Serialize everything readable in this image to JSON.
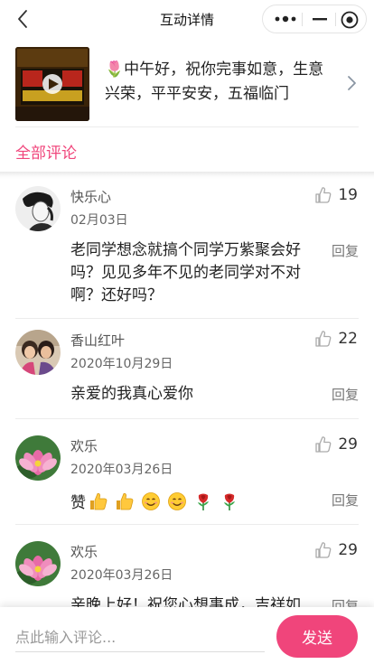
{
  "nav": {
    "title": "互动详情",
    "back_icon": "chevron-left-icon",
    "more_icon": "more-dots-icon",
    "minimize_icon": "minimize-icon",
    "close_icon": "target-circle-icon"
  },
  "post": {
    "text": "🌷中午好，祝你完事如意，生意兴荣，平平安安，五福临门",
    "thumbnail_icon": "video-thumbnail-icon",
    "arrow_icon": "chevron-right-icon"
  },
  "comments_header": "全部评论",
  "comments": [
    {
      "name": "快乐心",
      "date": "02月03日",
      "likes": "19",
      "text": "老同学想念就搞个同学万紫聚会好吗？见见多年不见的老同学对不对啊？还好吗？",
      "reply": "回复",
      "avatar": "sketch-avatar"
    },
    {
      "name": "香山红叶",
      "date": "2020年10月29日",
      "likes": "22",
      "text": "亲爱的我真心爱你",
      "reply": "回复",
      "avatar": "photo-avatar"
    },
    {
      "name": "欢乐",
      "date": "2020年03月26日",
      "likes": "29",
      "text": "赞",
      "reply": "回复",
      "avatar": "lotus-avatar",
      "emojis": [
        "thumbs-up-icon",
        "thumbs-up-icon",
        "smile-icon",
        "smile-icon",
        "rose-icon",
        "rose-icon"
      ]
    },
    {
      "name": "欢乐",
      "date": "2020年03月26日",
      "likes": "29",
      "text": "亲晚上好！祝您心想事成，吉祥如",
      "reply": "回复",
      "avatar": "lotus-avatar"
    }
  ],
  "input": {
    "placeholder": "点此输入评论..."
  },
  "send_label": "发送",
  "colors": {
    "accent": "#f0457b",
    "text": "#222222",
    "muted": "#777777"
  }
}
